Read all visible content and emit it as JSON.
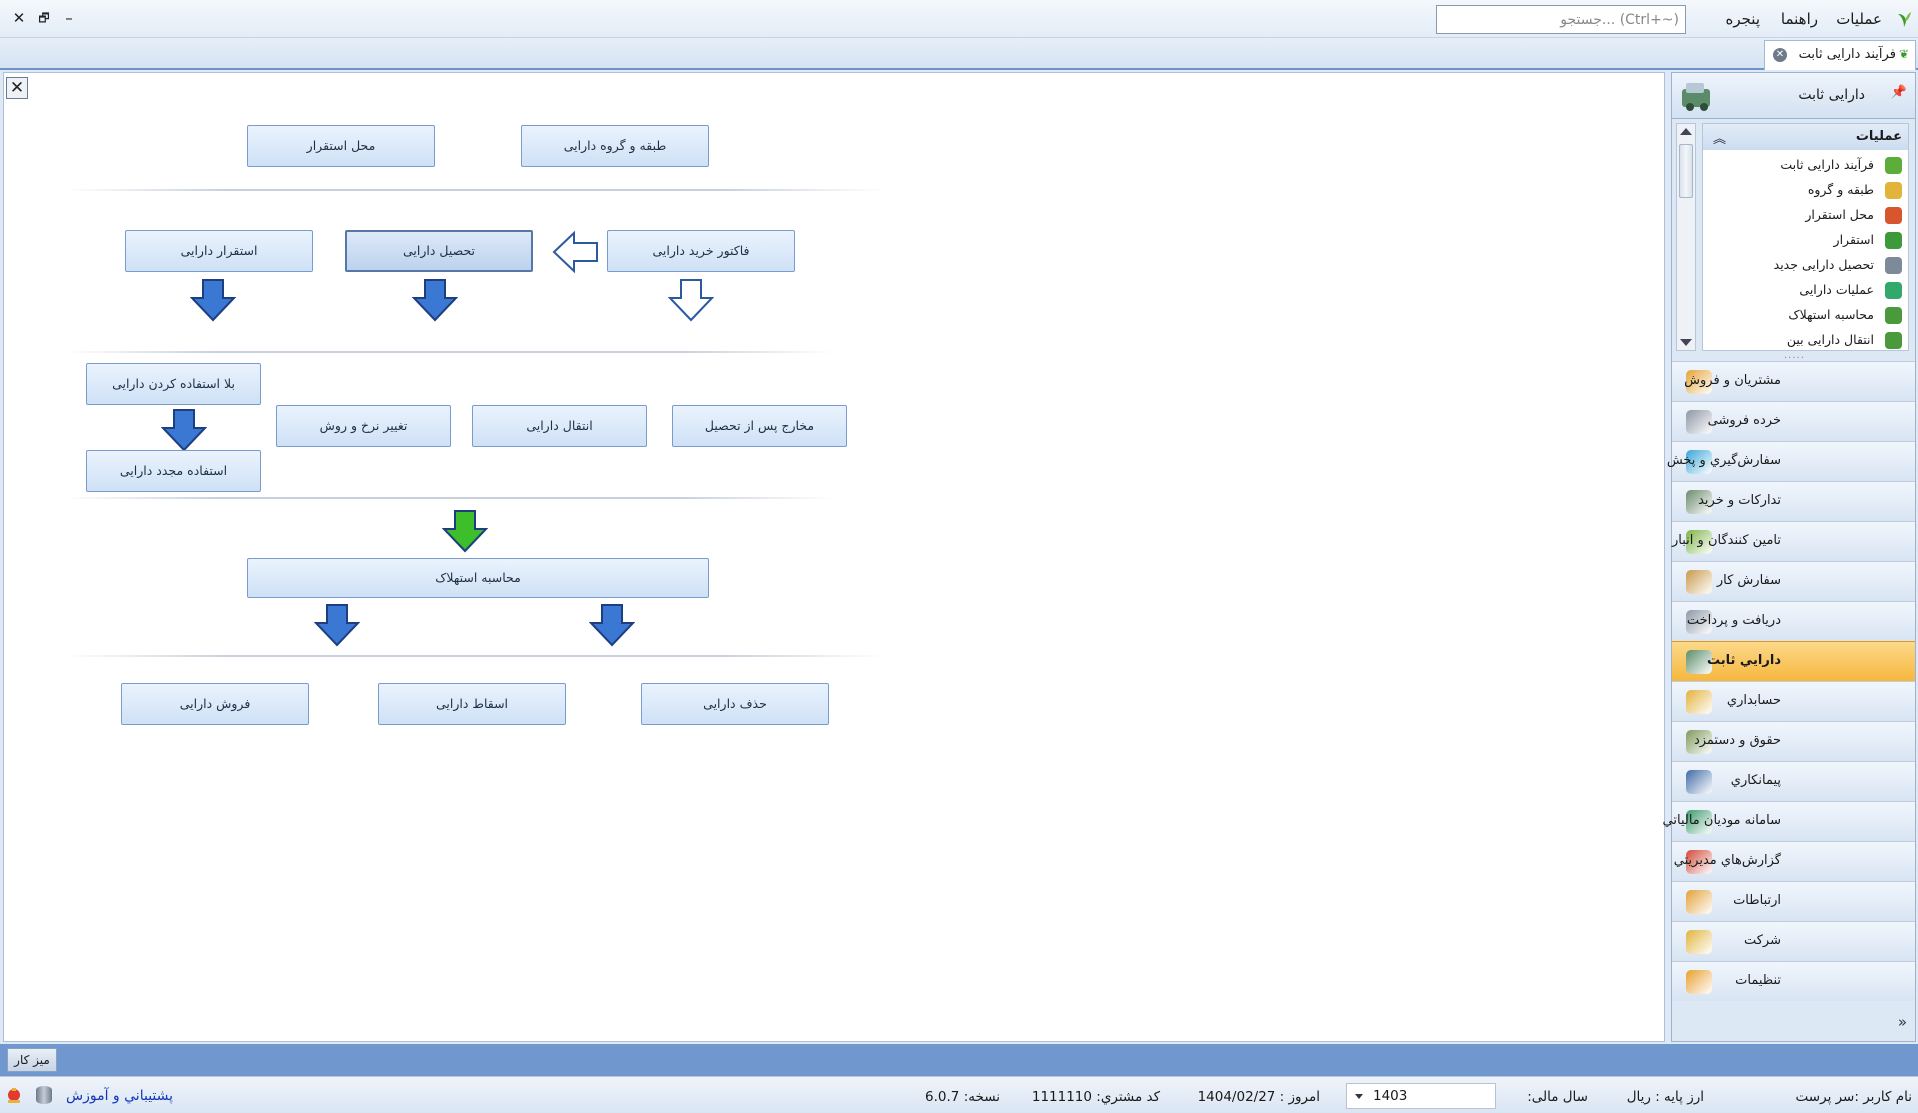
{
  "menu": {
    "items": [
      "عملیات",
      "راهنما",
      "پنجره"
    ],
    "search_placeholder": "جستجو... (Ctrl+~)",
    "window_close": "✕",
    "window_restore": "🗗",
    "window_minimize": "–"
  },
  "tab": {
    "label": "فرآیند دارایی ثابت"
  },
  "flow": {
    "close_label": "✕",
    "b_location": "محل استقرار",
    "b_class": "طبقه و گروه دارایی",
    "b_deploy": "استقرار دارایی",
    "b_acquire": "تحصیل دارایی",
    "b_invoice": "فاکتور خرید دارایی",
    "b_idle": "بلا استفاده کردن دارایی",
    "b_rate": "تغییر نرخ و روش",
    "b_transfer": "انتقال دارایی",
    "b_post_cost": "مخارج پس از تحصیل",
    "b_reuse": "استفاده مجدد دارایی",
    "b_depreciation": "محاسبه استهلاک",
    "b_sell": "فروش دارایی",
    "b_writeoff": "اسقاط دارایی",
    "b_delete": "حذف دارایی"
  },
  "nav": {
    "header": "دارایی ثابت",
    "ops_title": "عملیات",
    "ops_items": [
      {
        "label": "فرآیند دارایی ثابت",
        "icon": "tree-icon",
        "color": "#5cae3a"
      },
      {
        "label": "طبقه و گروه",
        "icon": "groups-icon",
        "color": "#e2b53a"
      },
      {
        "label": "محل استقرار",
        "icon": "box-icon",
        "color": "#d8562e"
      },
      {
        "label": "استقرار",
        "icon": "globe-icon",
        "color": "#3d9a3a"
      },
      {
        "label": "تحصیل دارایی جدید",
        "icon": "form-icon",
        "color": "#7d8a99"
      },
      {
        "label": "عملیات دارایی",
        "icon": "gear-icon",
        "color": "#34a86b"
      },
      {
        "label": "محاسبه استهلاک",
        "icon": "calculator-icon",
        "color": "#4a9a3c"
      },
      {
        "label": "انتقال دارایی بین",
        "icon": "transfer-icon",
        "color": "#4a9a3c"
      }
    ],
    "modules": [
      {
        "label": "مشتريان و فروش",
        "icon": "sales-chart-icon",
        "color": "#e4a437"
      },
      {
        "label": "خرده فروشی",
        "icon": "cart-icon",
        "color": "#8c96a4"
      },
      {
        "label": "سفارش‌گيري و پخش",
        "icon": "distribution-icon",
        "color": "#3aa6d9"
      },
      {
        "label": "تدارکات و خريد",
        "icon": "purchase-icon",
        "color": "#6b8a6d"
      },
      {
        "label": "تامين کنندگان و انبار",
        "icon": "warehouse-icon",
        "color": "#7cb446"
      },
      {
        "label": "سفارش کار",
        "icon": "work-order-icon",
        "color": "#c99a4b"
      },
      {
        "label": "دريافت و پرداخت",
        "icon": "payment-icon",
        "color": "#8d99a7"
      },
      {
        "label": "دارايي ثابت",
        "icon": "fixed-asset-icon",
        "color": "#5a8c6a"
      },
      {
        "label": "حسابداري",
        "icon": "accounting-icon",
        "color": "#e2b33c"
      },
      {
        "label": "حقوق و دستمزد",
        "icon": "payroll-icon",
        "color": "#7e9a5a"
      },
      {
        "label": "پيمانکاري",
        "icon": "contract-icon",
        "color": "#3f6aa8"
      },
      {
        "label": "سامانه موديان مالياتي",
        "icon": "tax-icon",
        "color": "#3c9a6c"
      },
      {
        "label": "گزارش‌هاي مديريتي",
        "icon": "report-icon",
        "color": "#d14a3a"
      },
      {
        "label": "ارتباطات",
        "icon": "communication-icon",
        "color": "#e2a23a"
      },
      {
        "label": "شرکت",
        "icon": "company-icon",
        "color": "#e0b53c"
      },
      {
        "label": "تنظيمات",
        "icon": "settings-icon",
        "color": "#e8a02e"
      }
    ],
    "active_index": 7,
    "chevron": "»"
  },
  "taskbar": {
    "desk_label": "میز کار"
  },
  "status": {
    "user": "نام کاربر :سر پرست",
    "currency": "ارز پایه :   ریال",
    "fiscal_label": "سال مالی:",
    "fiscal_year": "1403",
    "today": "امروز :   1404/02/27",
    "customer_code": "کد مشتري:   1111110",
    "version": "نسخه:   6.0.7",
    "support": "پشتيباني و آموزش"
  }
}
